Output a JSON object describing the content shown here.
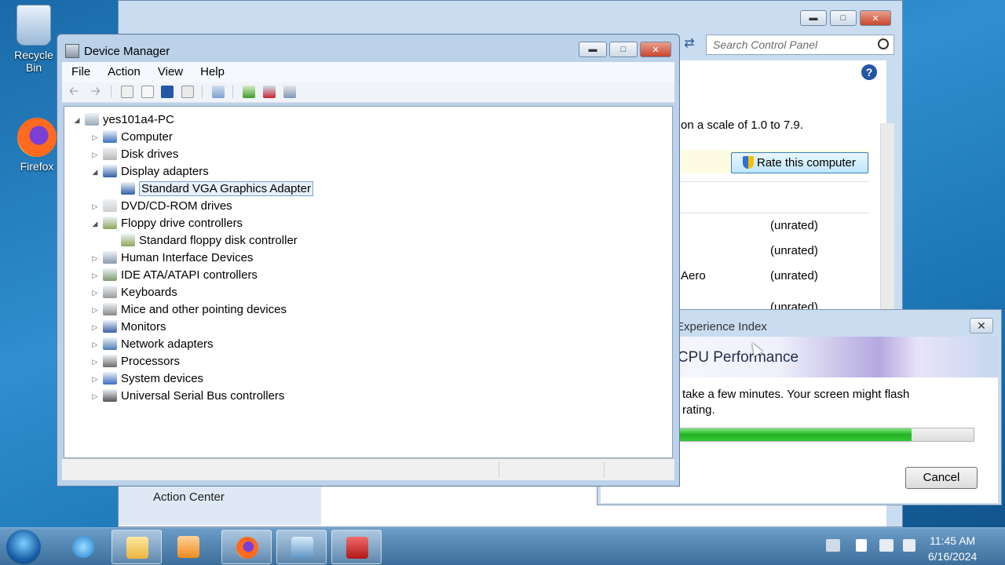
{
  "desktop": {
    "icons": [
      {
        "label": "Recycle Bin",
        "icon": "recycle-bin-icon"
      },
      {
        "label": "Firefox",
        "icon": "firefox-icon"
      }
    ]
  },
  "control_panel": {
    "search_placeholder": "Search Control Panel",
    "scale_text": "on a scale of 1.0 to 7.9.",
    "rate_button": "Rate this computer",
    "rows": [
      {
        "label": "",
        "value": "(unrated)"
      },
      {
        "label": "",
        "value": "(unrated)"
      },
      {
        "label": "Aero",
        "value": "(unrated)"
      },
      {
        "label": "",
        "value": "(unrated)"
      }
    ],
    "sidebar_link": "Action Center"
  },
  "wei_dialog": {
    "title": "Experience Index",
    "banner": "g CPU Performance",
    "message_line1": "take a few minutes. Your screen might flash",
    "message_line2": "rating.",
    "progress": 0.79,
    "cancel_label": "Cancel"
  },
  "device_manager": {
    "title": "Device Manager",
    "menu": [
      "File",
      "Action",
      "View",
      "Help"
    ],
    "tree": [
      {
        "label": "yes101a4-PC",
        "level": 0,
        "expanded": true,
        "icon": "computer-root-icon"
      },
      {
        "label": "Computer",
        "level": 1,
        "expanded": false,
        "icon": "computer-icon"
      },
      {
        "label": "Disk drives",
        "level": 1,
        "expanded": false,
        "icon": "disk-drive-icon"
      },
      {
        "label": "Display adapters",
        "level": 1,
        "expanded": true,
        "icon": "display-adapter-icon"
      },
      {
        "label": "Standard VGA Graphics Adapter",
        "level": 2,
        "selected": true,
        "icon": "display-adapter-icon"
      },
      {
        "label": "DVD/CD-ROM drives",
        "level": 1,
        "expanded": false,
        "icon": "dvd-drive-icon"
      },
      {
        "label": "Floppy drive controllers",
        "level": 1,
        "expanded": true,
        "icon": "floppy-controller-icon"
      },
      {
        "label": "Standard floppy disk controller",
        "level": 2,
        "icon": "floppy-controller-icon"
      },
      {
        "label": "Human Interface Devices",
        "level": 1,
        "expanded": false,
        "icon": "hid-icon"
      },
      {
        "label": "IDE ATA/ATAPI controllers",
        "level": 1,
        "expanded": false,
        "icon": "ide-controller-icon"
      },
      {
        "label": "Keyboards",
        "level": 1,
        "expanded": false,
        "icon": "keyboard-icon"
      },
      {
        "label": "Mice and other pointing devices",
        "level": 1,
        "expanded": false,
        "icon": "mouse-icon"
      },
      {
        "label": "Monitors",
        "level": 1,
        "expanded": false,
        "icon": "monitor-icon"
      },
      {
        "label": "Network adapters",
        "level": 1,
        "expanded": false,
        "icon": "network-adapter-icon"
      },
      {
        "label": "Processors",
        "level": 1,
        "expanded": false,
        "icon": "processor-icon"
      },
      {
        "label": "System devices",
        "level": 1,
        "expanded": false,
        "icon": "system-device-icon"
      },
      {
        "label": "Universal Serial Bus controllers",
        "level": 1,
        "expanded": false,
        "icon": "usb-icon"
      }
    ]
  },
  "taskbar": {
    "apps": [
      "internet-explorer-icon",
      "windows-explorer-icon",
      "media-center-icon",
      "firefox-icon",
      "control-panel-icon",
      "device-manager-icon"
    ],
    "time": "11:45 AM",
    "date": "6/16/2024"
  },
  "colors": {
    "accent": "#3c7fb1",
    "progress_fill": "#1fb21f",
    "close_button": "#c8462e"
  }
}
